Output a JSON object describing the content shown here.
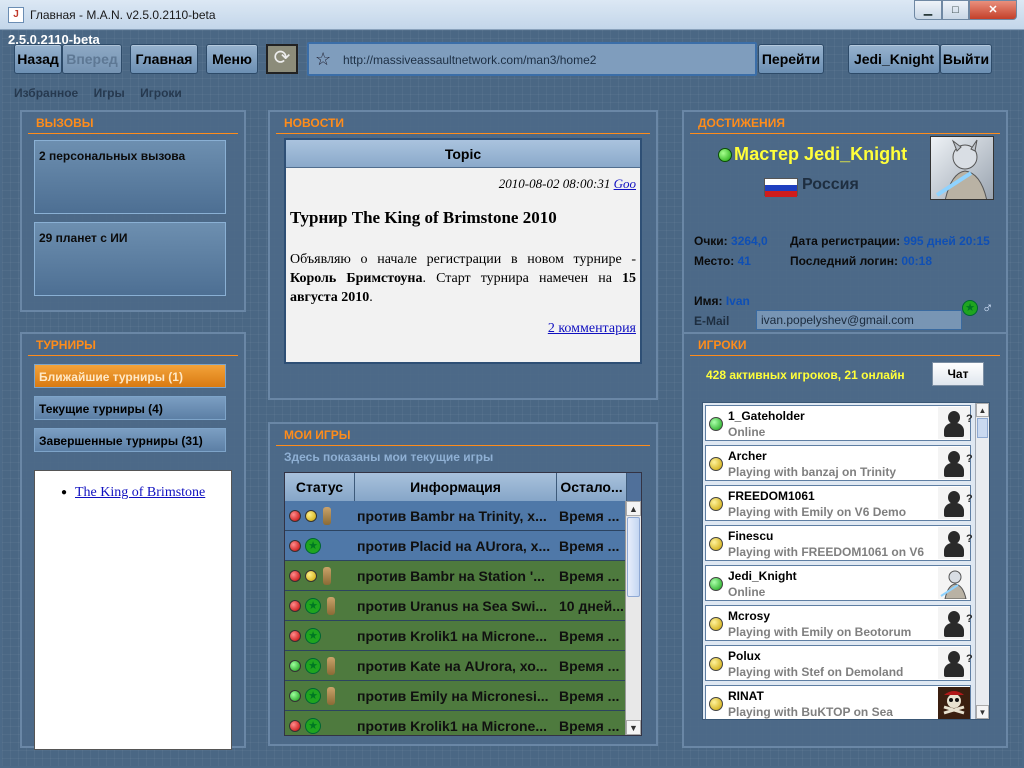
{
  "window": {
    "title": "Главная - M.A.N. v2.5.0.2110-beta",
    "app_icon": "java-icon"
  },
  "version": "2.5.0.2110-beta",
  "toolbar": {
    "back": "Назад",
    "forward": "Вперед",
    "home": "Главная",
    "menu": "Меню",
    "url": "http://massiveassaultnetwork.com/man3/home2",
    "go": "Перейти",
    "user": "Jedi_Knight",
    "logout": "Выйти"
  },
  "links": [
    "Избранное",
    "Игры",
    "Игроки"
  ],
  "challenges": {
    "title": "ВЫЗОВЫ",
    "items": [
      "2 персональных вызова",
      "29 планет с ИИ"
    ]
  },
  "tournaments": {
    "title": "ТУРНИРЫ",
    "tabs": [
      "Ближайшие турниры (1)",
      "Текущие турниры (4)",
      "Завершенные турниры (31)"
    ],
    "list": [
      "The King of Brimstone"
    ]
  },
  "news": {
    "title": "НОВОСТИ",
    "header": "Topic",
    "date": "2010-08-02 08:00:31",
    "date_link": "Goo",
    "headline": "Турнир The King of Brimstone 2010",
    "text_before": "Объявляю о начале регистрации в новом турнире - ",
    "text_bold1": "Король Бримстоуна",
    "text_mid": ". Старт турнира намечен на ",
    "text_bold2": "15 августа 2010",
    "text_end": ".",
    "comments": "2 комментария"
  },
  "my_games": {
    "title": "МОИ ИГРЫ",
    "hint": "Здесь показаны мои текущие игры",
    "columns": [
      "Статус",
      "Информация",
      "Остало..."
    ],
    "rows": [
      {
        "info": "против Bambr на Trinity, х...",
        "time": "Время ...",
        "bg": "#4f78a8",
        "icons": [
          "red",
          "yellow",
          "medal"
        ]
      },
      {
        "info": "против Placid на AUrora, х...",
        "time": "Время ...",
        "bg": "#4f78a8",
        "icons": [
          "red",
          "star"
        ]
      },
      {
        "info": "против Bambr на Station '...",
        "time": "Время ...",
        "bg": "#4e7a3e",
        "icons": [
          "red",
          "yellow",
          "medal"
        ]
      },
      {
        "info": "против Uranus на Sea Swi...",
        "time": "10 дней...",
        "bg": "#4e7a3e",
        "icons": [
          "red",
          "star",
          "medal"
        ]
      },
      {
        "info": "против Krolik1 на Microne...",
        "time": "Время ...",
        "bg": "#4e7a3e",
        "icons": [
          "red",
          "star"
        ]
      },
      {
        "info": "против Kate на AUrora, хо...",
        "time": "Время ...",
        "bg": "#4e7a3e",
        "icons": [
          "green",
          "star",
          "medal"
        ]
      },
      {
        "info": "против Emily на Micronesi...",
        "time": "Время ...",
        "bg": "#4e7a3e",
        "icons": [
          "green",
          "star",
          "medal"
        ]
      },
      {
        "info": "против Krolik1 на Microne...",
        "time": "Время ...",
        "bg": "#4e7a3e",
        "icons": [
          "red",
          "star"
        ]
      }
    ]
  },
  "achievements": {
    "title": "ДОСТИЖЕНИЯ",
    "name": "Мастер Jedi_Knight",
    "country": "Россия",
    "points_label": "Очки:",
    "points": "3264,0",
    "place_label": "Место:",
    "place": "41",
    "reg_label": "Дата регистрации:",
    "reg": "995 дней 20:15",
    "login_label": "Последний логин:",
    "login": "00:18",
    "name_label": "Имя:",
    "first_name": "Ivan",
    "email_label": "E-Mail",
    "email": "ivan.popelyshev@gmail.com"
  },
  "players": {
    "title": "ИГРОКИ",
    "count": "428 активных игроков, 21 онлайн",
    "chat": "Чат",
    "list": [
      {
        "name": "1_Gateholder",
        "status": "Online",
        "dot": "green",
        "avatar": "unknown"
      },
      {
        "name": "Archer",
        "status": "Playing with banzaj on Trinity",
        "dot": "yellow",
        "avatar": "unknown"
      },
      {
        "name": "FREEDOM1061",
        "status": "Playing with Emily on V6 Demo",
        "dot": "yellow",
        "avatar": "unknown"
      },
      {
        "name": "Finescu",
        "status": "Playing with FREEDOM1061 on V6",
        "dot": "yellow",
        "avatar": "unknown"
      },
      {
        "name": "Jedi_Knight",
        "status": "Online",
        "dot": "green",
        "avatar": "jedi"
      },
      {
        "name": "Mcrosy",
        "status": "Playing with Emily on Beotorum",
        "dot": "yellow",
        "avatar": "unknown"
      },
      {
        "name": "Polux",
        "status": "Playing with Stef on Demoland",
        "dot": "yellow",
        "avatar": "unknown"
      },
      {
        "name": "RINAT",
        "status": "Playing with BuKTOP on Sea",
        "dot": "yellow",
        "avatar": "pirate"
      }
    ]
  }
}
